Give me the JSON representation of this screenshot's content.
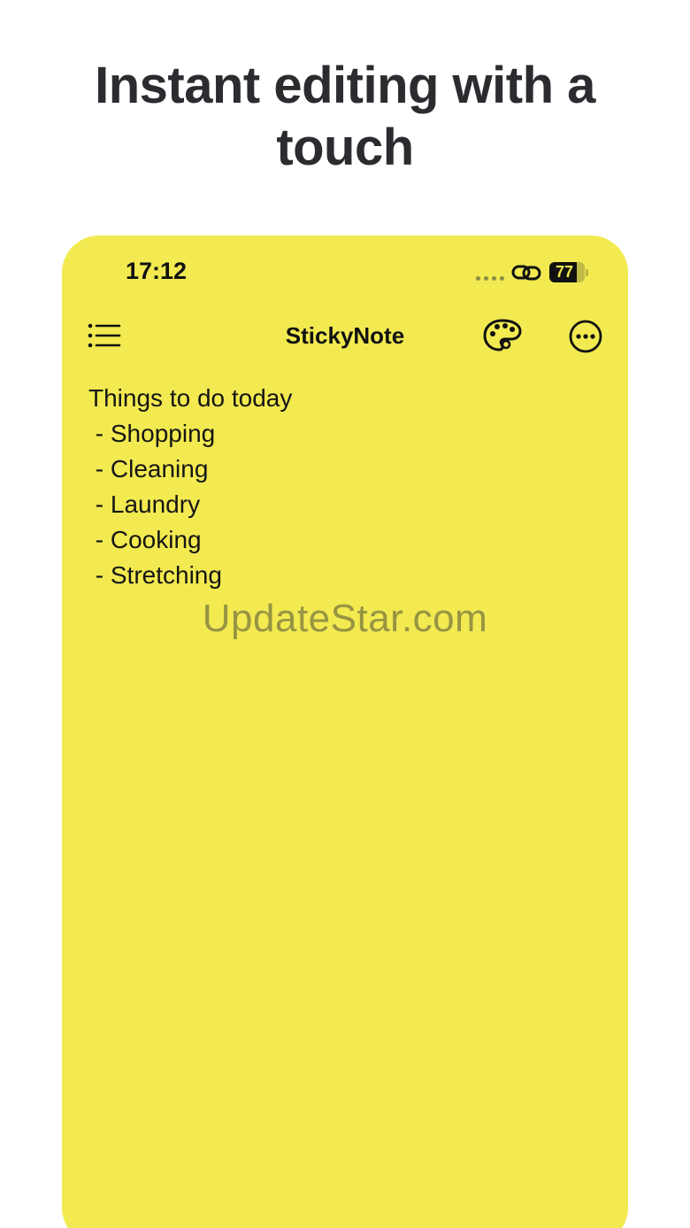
{
  "headline": "Instant editing with a touch",
  "colors": {
    "note_background": "#f2ea50",
    "text": "#111111",
    "headline": "#2a2c2f"
  },
  "status_bar": {
    "time": "17:12",
    "battery_level": "77",
    "battery_fraction": 0.77,
    "icons": [
      "signal-dots-icon",
      "link-icon",
      "battery-icon"
    ]
  },
  "toolbar": {
    "menu_icon": "list-icon",
    "title": "StickyNote",
    "palette_icon": "palette-icon",
    "more_icon": "ellipsis-circle-icon"
  },
  "note": {
    "lines": [
      "Things to do today",
      " - Shopping",
      " - Cleaning",
      " - Laundry",
      " - Cooking",
      " - Stretching"
    ]
  },
  "watermark": "UpdateStar.com"
}
